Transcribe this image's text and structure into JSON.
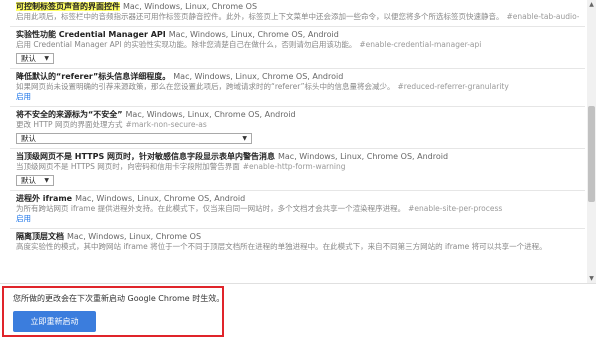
{
  "flags": [
    {
      "title": "可控制标签页声音的界面控件",
      "platforms": "Mac, Windows, Linux, Chrome OS",
      "desc": "启用此项后，标签栏中的音频指示器还可用作标签页静音控件。此外，标签页上下文菜单中还会添加一些命令，以便您将多个所选标签页快速静音。",
      "hash": "#enable-tab-audio-muting",
      "action": "",
      "select": ""
    },
    {
      "title": "实验性功能 Credential Manager API",
      "platforms": "Mac, Windows, Linux, Chrome OS, Android",
      "desc": "启用 Credential Manager API 的实验性实现功能。除非您清楚自己在做什么，否则请勿启用该功能。",
      "hash": "#enable-credential-manager-api",
      "action": "",
      "select": "默认"
    },
    {
      "title": "降低默认的“referer”标头信息详细程度。",
      "platforms": "Mac, Windows, Linux, Chrome OS, Android",
      "desc": "如果网页尚未设置明确的引荐来源政策，那么在您设置此项后，跨域请求时的“referer”标头中的信息量将会减少。",
      "hash": "#reduced-referrer-granularity",
      "action": "启用",
      "select": ""
    },
    {
      "title": "将不安全的来源标为“不安全”",
      "platforms": "Mac, Windows, Linux, Chrome OS, Android",
      "desc": "更改 HTTP 网页的界面处理方式",
      "hash": "#mark-non-secure-as",
      "action": "",
      "select": "默认"
    },
    {
      "title": "当顶级网页不是 HTTPS 网页时，针对敏感信息字段显示表单内警告消息",
      "platforms": "Mac, Windows, Linux, Chrome OS, Android",
      "desc": "当顶级网页不是 HTTPS 网页时，向密码和信用卡字段附加警告界面",
      "hash": "#enable-http-form-warning",
      "action": "",
      "select": "默认"
    },
    {
      "title": "进程外 iframe",
      "platforms": "Mac, Windows, Linux, Chrome OS, Android",
      "desc": "为所有跨站网页 iframe 提供进程外支持。在此模式下，仅当来自同一网站时，多个文档才会共享一个渲染程序进程。",
      "hash": "#enable-site-per-process",
      "action": "启用",
      "select": ""
    },
    {
      "title": "隔离顶层文档",
      "platforms": "Mac, Windows, Linux, Chrome OS",
      "desc": "高度实验性的模式，其中跨网站 iframe 将位于一个不同于顶层文档所在进程的单独进程中。在此模式下，来自不同第三方网站的 iframe 将可以共享一个进程。",
      "hash": "",
      "action": "",
      "select": ""
    }
  ],
  "relaunch": {
    "message": "您所做的更改会在下次重新启动 Google Chrome 时生效。",
    "button": "立即重新启动"
  },
  "colors": {
    "button": "#3b7ddd",
    "highlight_border": "#e0242a",
    "search_highlight": "#ffff66"
  }
}
